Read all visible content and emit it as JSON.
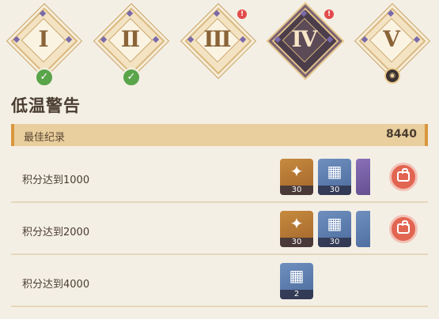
{
  "stages": [
    {
      "numeral": "I",
      "status": "completed",
      "icon": "check-icon"
    },
    {
      "numeral": "II",
      "status": "completed",
      "icon": "check-icon"
    },
    {
      "numeral": "III",
      "status": "alert",
      "icon": "exclamation-icon"
    },
    {
      "numeral": "IV",
      "status": "selected",
      "icon": "exclamation-icon"
    },
    {
      "numeral": "V",
      "status": "locked",
      "icon": "lock-icon"
    }
  ],
  "badges": {
    "check": "✓",
    "alert": "!",
    "lock": "🔒"
  },
  "title": "低温警告",
  "best": {
    "label": "最佳纪录",
    "value": "8440"
  },
  "rows": [
    {
      "label": "积分达到1000",
      "rewards": [
        {
          "icon": "primogem-icon",
          "qty": "30"
        },
        {
          "icon": "card-icon",
          "qty": "30"
        },
        {
          "icon": "book-icon",
          "qty": ""
        }
      ]
    },
    {
      "label": "积分达到2000",
      "rewards": [
        {
          "icon": "primogem-icon",
          "qty": "30"
        },
        {
          "icon": "card-icon",
          "qty": "30"
        },
        {
          "icon": "book-icon",
          "qty": ""
        }
      ]
    },
    {
      "label": "积分达到4000",
      "rewards": [
        {
          "icon": "card-icon",
          "qty": "2"
        }
      ]
    }
  ],
  "colors": {
    "accent": "#d9963c",
    "claim": "#e26552",
    "active_stage": "#4b3d4a"
  }
}
